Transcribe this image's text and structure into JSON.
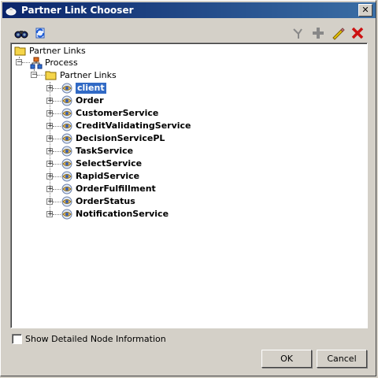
{
  "window": {
    "title": "Partner Link Chooser",
    "close_label": "✕"
  },
  "toolbar": {
    "left_icons": [
      "binoculars-icon",
      "refresh-icon"
    ],
    "right_icons": [
      "wand-icon",
      "add-icon",
      "edit-icon",
      "delete-icon"
    ]
  },
  "tree": {
    "root_label": "Partner Links",
    "process_label": "Process",
    "group_label": "Partner Links",
    "items": [
      {
        "label": "client",
        "selected": true
      },
      {
        "label": "Order",
        "selected": false
      },
      {
        "label": "CustomerService",
        "selected": false
      },
      {
        "label": "CreditValidatingService",
        "selected": false
      },
      {
        "label": "DecisionServicePL",
        "selected": false
      },
      {
        "label": "TaskService",
        "selected": false
      },
      {
        "label": "SelectService",
        "selected": false
      },
      {
        "label": "RapidService",
        "selected": false
      },
      {
        "label": "OrderFulfillment",
        "selected": false
      },
      {
        "label": "OrderStatus",
        "selected": false
      },
      {
        "label": "NotificationService",
        "selected": false
      }
    ]
  },
  "options": {
    "show_detailed_label": "Show Detailed Node Information",
    "show_detailed_checked": false
  },
  "buttons": {
    "ok_label": "OK",
    "cancel_label": "Cancel"
  },
  "colors": {
    "selection": "#316ac5",
    "title_start": "#0a246a",
    "delete_red": "#cc1111"
  }
}
